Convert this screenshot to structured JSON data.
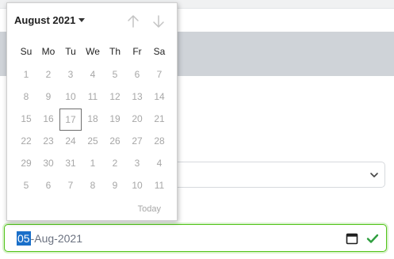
{
  "date_input": {
    "day": "05",
    "month": "Aug",
    "year": "2021",
    "separator": "-"
  },
  "calendar": {
    "month_label": "August 2021",
    "weekdays": [
      "Su",
      "Mo",
      "Tu",
      "We",
      "Th",
      "Fr",
      "Sa"
    ],
    "weeks": [
      [
        "1",
        "2",
        "3",
        "4",
        "5",
        "6",
        "7"
      ],
      [
        "8",
        "9",
        "10",
        "11",
        "12",
        "13",
        "14"
      ],
      [
        "15",
        "16",
        "17",
        "18",
        "19",
        "20",
        "21"
      ],
      [
        "22",
        "23",
        "24",
        "25",
        "26",
        "27",
        "28"
      ],
      [
        "29",
        "30",
        "31",
        "1",
        "2",
        "3",
        "4"
      ],
      [
        "5",
        "6",
        "7",
        "8",
        "9",
        "10",
        "11"
      ]
    ],
    "today_value": "17",
    "today_button": "Today"
  },
  "icons": {
    "previous_month": "arrow-up-icon",
    "next_month": "arrow-down-icon",
    "calendar": "calendar-icon",
    "valid": "checkmark-icon",
    "select_chevron": "chevron-down-icon"
  },
  "colors": {
    "valid_border": "#52c41a",
    "selection": "#1a6fc9",
    "muted_day": "#a7a7a7"
  }
}
